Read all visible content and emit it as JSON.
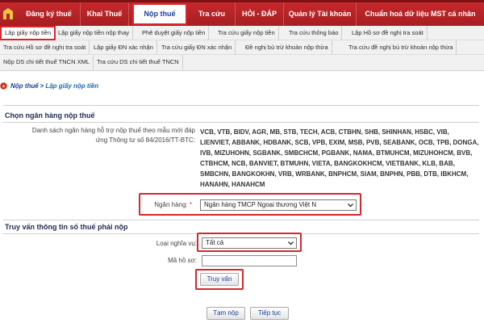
{
  "nav": {
    "items": [
      "Đăng ký thuế",
      "Khai Thuế",
      "Nộp thuế",
      "Tra cứu",
      "HỎI - ĐÁP",
      "Quản lý Tài khoản",
      "Chuẩn hoá dữ liệu MST cá nhân"
    ],
    "active_index": 2
  },
  "submenu": {
    "row1": [
      "Lập giấy nộp tiền",
      "Lập giấy nộp tiền nộp thay",
      "Phê duyệt giấy nộp tiền",
      "Tra cứu giấy nộp tiền",
      "Tra cứu thông báo",
      "Lập Hồ sơ đề nghị tra soát"
    ],
    "row2": [
      "Tra cứu Hồ sơ đề nghị tra soát",
      "Lập giấy ĐN xác nhận",
      "Tra cứu giấy ĐN xác nhận",
      "Đề nghị bù trừ khoản nộp thừa",
      "Tra cứu đề nghị bù trừ khoản nộp thừa"
    ],
    "row3": [
      "Nộp DS chi tiết thuế TNCN XML",
      "Tra cứu DS chi tiết thuế TNCN"
    ]
  },
  "breadcrumb": {
    "section": "Nộp thuế",
    "separator": ">",
    "current": "Lập giấy nộp tiền"
  },
  "bank_section": {
    "title": "Chọn ngân hàng nộp thuế",
    "list_label_line1": "Danh sách ngân hàng hỗ trợ nộp thuế theo mẫu mới đáp",
    "list_label_line2": "ứng Thông tư số 84/2016/TT-BTC:",
    "bank_list": "VCB, VTB, BIDV, AGR, MB, STB, TECH, ACB, CTBHN, SHB, SHINHAN, HSBC, VIB, LIENVIET, ABBANK, HDBANK, SCB, VPB, EXIM, MSB, PVB, SEABANK, OCB, TPB, DONGA, IVB, MIZUHOHN, SGBANK, SMBCHCM, PGBANK, NAMA, BTMUHCM, MIZUHOHCM, BVB, CTBHCM, NCB, BANVIET, BTMUHN, VIETA, BANGKOKHCM, VIETBANK, KLB, BAB, SMBCHN, BANGKOKHN, VRB, WRBANK, BNPHCM, SIAM, BNPHN, PBB, DTB, IBKHCM, HANAHN, HANAHCM",
    "bank_label": "Ngân hàng:",
    "required_mark": "*",
    "bank_selected": "Ngân hàng TMCP Ngoại thương Việt N"
  },
  "query_section": {
    "title": "Truy vấn thông tin số thuế phải nộp",
    "obligation_label": "Loại nghĩa vụ:",
    "obligation_selected": "Tất cả",
    "file_code_label": "Mã hồ sơ:",
    "file_code_value": "",
    "query_button": "Truy vấn"
  },
  "footer": {
    "pay_button": "Tạm nộp",
    "continue_button": "Tiếp tục"
  },
  "colors": {
    "nav_red": "#b52226",
    "highlight_red": "#d7272b",
    "link_blue": "#1a3f9a"
  }
}
